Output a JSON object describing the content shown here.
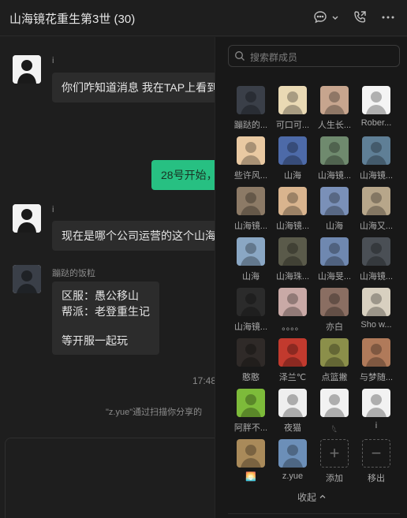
{
  "header": {
    "title": "山海镜花重生第3世 (30)"
  },
  "chat": {
    "messages": [
      {
        "sender": "i",
        "text": "你们咋知道消息 我在TAP上看到"
      },
      {
        "text": "28号开始，"
      },
      {
        "sender": "i",
        "text": "现在是哪个公司运营的这个山海"
      },
      {
        "sender": "蹦跶的饭粒",
        "lines": [
          "区服：愚公移山",
          "帮派：老登重生记",
          "",
          "等开服一起玩"
        ]
      }
    ],
    "timestamp": "17:48",
    "system_message": "\"z.yue\"通过扫描你分享的"
  },
  "panel": {
    "search_placeholder": "搜索群成员",
    "members": [
      {
        "name": "蹦跶的...",
        "color": "#3a3f48"
      },
      {
        "name": "可口可...",
        "color": "#e9d9b4"
      },
      {
        "name": "人生长...",
        "color": "#c7a58e"
      },
      {
        "name": "Rober...",
        "color": "#f4f4f4"
      },
      {
        "name": "些许风...",
        "color": "#e9c9a2"
      },
      {
        "name": "山海",
        "color": "#4d6aa8"
      },
      {
        "name": "山海镜...",
        "color": "#6f8a6e"
      },
      {
        "name": "山海镜...",
        "color": "#5f7f96"
      },
      {
        "name": "山海镜...",
        "color": "#8c7a66"
      },
      {
        "name": "山海镜...",
        "color": "#d9b48e"
      },
      {
        "name": "山海",
        "color": "#7a90b8"
      },
      {
        "name": "山海又...",
        "color": "#b7a68a"
      },
      {
        "name": "山海",
        "color": "#8aa7c4"
      },
      {
        "name": "山海珠...",
        "color": "#5a5a4a"
      },
      {
        "name": "山海旻...",
        "color": "#6f88b0"
      },
      {
        "name": "山海镜...",
        "color": "#4a4f55"
      },
      {
        "name": "山海镜...",
        "color": "#2b2b2b"
      },
      {
        "name": "。。。。",
        "color": "#c9a9a6"
      },
      {
        "name": "亦白",
        "color": "#8a6e62"
      },
      {
        "name": "Sho w...",
        "color": "#d8d0c0"
      },
      {
        "name": "憨憨",
        "color": "#2f2a28"
      },
      {
        "name": "泽兰℃",
        "color": "#c23a2e"
      },
      {
        "name": "点篮撇",
        "color": "#8b8f4a"
      },
      {
        "name": "与梦随...",
        "color": "#b07a5a"
      },
      {
        "name": "阿胖不...",
        "color": "#7dbb3a"
      },
      {
        "name": "夜猫",
        "color": "#efefef"
      },
      {
        "name": "𓆩",
        "color": "#f2f2f2"
      },
      {
        "name": "i",
        "color": "#f2f2f2"
      },
      {
        "name": "🌅",
        "color": "#a98a5a"
      },
      {
        "name": "z.yue",
        "color": "#6c8fb8"
      }
    ],
    "add_label": "添加",
    "remove_label": "移出",
    "collapse_label": "收起"
  }
}
